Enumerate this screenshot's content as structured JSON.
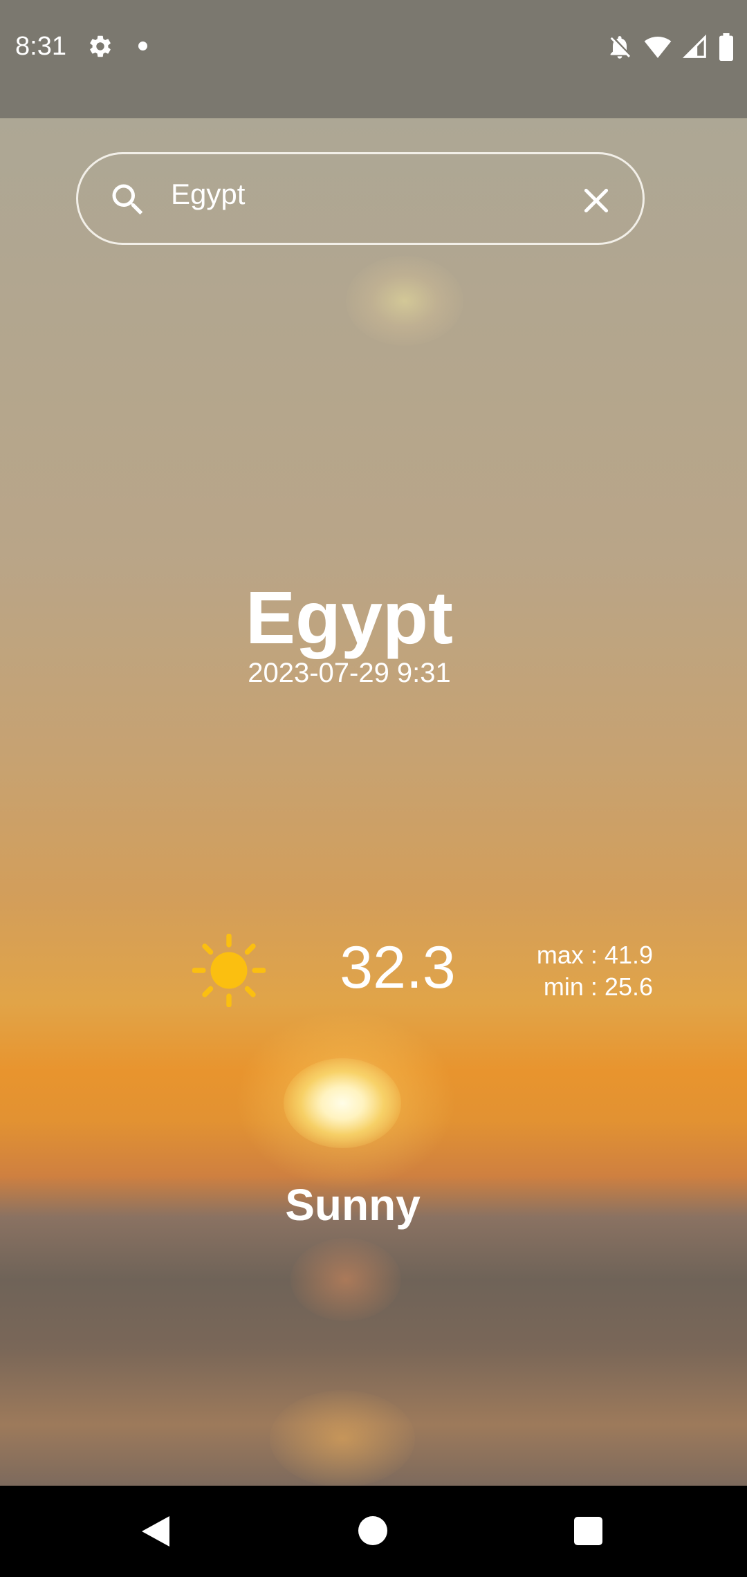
{
  "status_bar": {
    "time": "8:31",
    "icons": [
      "settings-icon",
      "notification-dot",
      "notifications-off-icon",
      "wifi-icon",
      "cellular-signal-icon",
      "battery-icon"
    ]
  },
  "search": {
    "value": "Egypt",
    "placeholder": ""
  },
  "location": {
    "city": "Egypt",
    "datetime": "2023-07-29 9:31"
  },
  "weather": {
    "icon": "sun-icon",
    "temperature": "32.3",
    "max": "max : 41.9",
    "min": "min : 25.6",
    "condition": "Sunny"
  },
  "colors": {
    "sun_icon": "#fbbf10",
    "text": "#ffffff"
  },
  "nav_bar": {
    "icons": [
      "back-icon",
      "home-icon",
      "recents-icon"
    ]
  }
}
